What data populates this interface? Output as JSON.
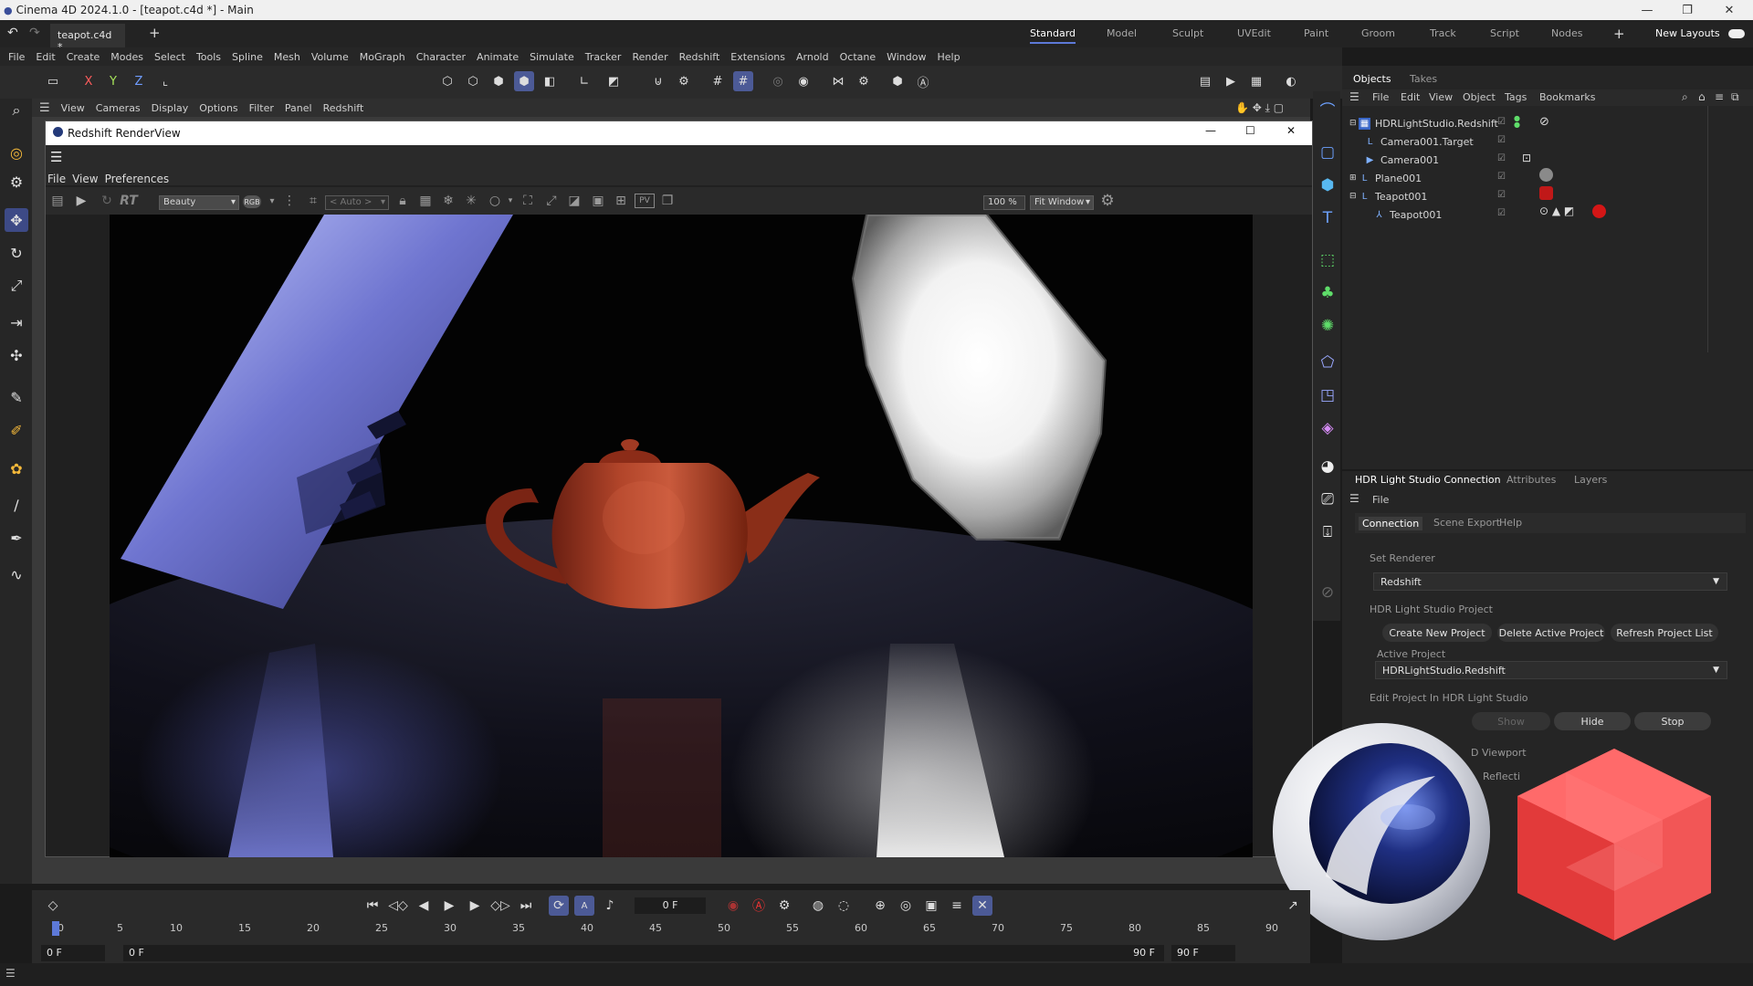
{
  "window": {
    "title": "Cinema 4D 2024.1.0 - [teapot.c4d *] - Main"
  },
  "tabs": {
    "doc_tab": "teapot.c4d *",
    "add": "+"
  },
  "layouts": {
    "items": [
      "Standard",
      "Model",
      "Sculpt",
      "UVEdit",
      "Paint",
      "Groom",
      "Track",
      "Script",
      "Nodes"
    ],
    "active": "Standard",
    "new_layouts": "New Layouts"
  },
  "menubar": [
    "File",
    "Edit",
    "Create",
    "Modes",
    "Select",
    "Tools",
    "Spline",
    "Mesh",
    "Volume",
    "MoGraph",
    "Character",
    "Animate",
    "Simulate",
    "Tracker",
    "Render",
    "Redshift",
    "Extensions",
    "Arnold",
    "Octane",
    "Window",
    "Help"
  ],
  "toolbar": {
    "axis_x": "X",
    "axis_y": "Y",
    "axis_z": "Z"
  },
  "viewport_menu": [
    "View",
    "Cameras",
    "Display",
    "Options",
    "Filter",
    "Panel",
    "Redshift"
  ],
  "renderview": {
    "title": "Redshift RenderView",
    "menu": [
      "File",
      "View",
      "Preferences"
    ],
    "rt_label": "RT",
    "aov": "Beauty",
    "rgb": "RGB",
    "auto": "< Auto >",
    "pv": "PV",
    "zoom": "100 %",
    "fit": "Fit Window"
  },
  "objects_panel": {
    "tabs": [
      "Objects",
      "Takes"
    ],
    "menu": [
      "File",
      "Edit",
      "View",
      "Object",
      "Tags",
      "Bookmarks"
    ],
    "rows": [
      {
        "name": "HDRLightStudio.Redshift",
        "icon": "hdr-light-studio-icon"
      },
      {
        "name": "Camera001.Target",
        "icon": "null-target-icon"
      },
      {
        "name": "Camera001",
        "icon": "camera-icon"
      },
      {
        "name": "Plane001",
        "icon": "plane-icon"
      },
      {
        "name": "Teapot001",
        "icon": "polygon-object-icon"
      },
      {
        "name": "Teapot001",
        "icon": "bone-icon"
      }
    ]
  },
  "attributes_panel": {
    "tabs": [
      "HDR Light Studio Connection",
      "Attributes",
      "Layers"
    ],
    "menu": "File",
    "subtabs": [
      "Connection",
      "Scene Export",
      "Help"
    ],
    "set_renderer_label": "Set Renderer",
    "renderer": "Redshift",
    "project_label": "HDR Light Studio Project",
    "buttons": [
      "Create New Project",
      "Delete Active Project",
      "Refresh Project List"
    ],
    "active_project_label": "Active Project",
    "active_project": "HDRLightStudio.Redshift",
    "edit_label": "Edit Project In HDR Light Studio",
    "edit_buttons": [
      "Show",
      "Hide",
      "Stop"
    ],
    "viewport_label": "D Viewport",
    "reflect_label": "Reflecti"
  },
  "timeline": {
    "ticks": [
      "0",
      "5",
      "10",
      "15",
      "20",
      "25",
      "30",
      "35",
      "40",
      "45",
      "50",
      "55",
      "60",
      "65",
      "70",
      "75",
      "80",
      "85",
      "90"
    ],
    "current_frame": "0 F",
    "start_left": "0 F",
    "start": "0 F",
    "end": "90 F",
    "end_right": "90 F"
  },
  "colors": {
    "accent": "#5d79d8",
    "teapot": "#a03a22",
    "redshift": "#f04848"
  }
}
